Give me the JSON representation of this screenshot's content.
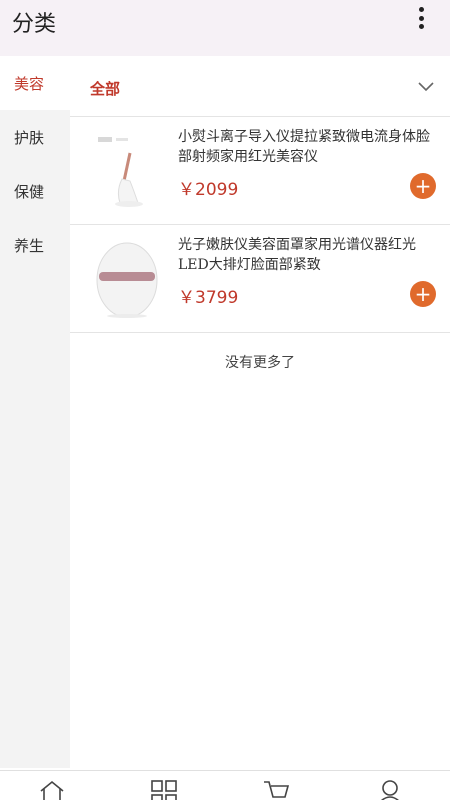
{
  "header": {
    "title": "分类",
    "menu_icon": "more-vertical-icon"
  },
  "sidebar": {
    "items": [
      {
        "label": "美容",
        "active": true
      },
      {
        "label": "护肤",
        "active": false
      },
      {
        "label": "保健",
        "active": false
      },
      {
        "label": "养生",
        "active": false
      }
    ]
  },
  "category": {
    "label": "全部",
    "expand_icon": "chevron-down-icon"
  },
  "products": [
    {
      "name": "小熨斗离子导入仪提拉紧致微电流身体脸部射频家用红光美容仪",
      "price": "￥2099",
      "add_icon": "plus-icon"
    },
    {
      "name": "光子嫩肤仪美容面罩家用光谱仪器红光LED大排灯脸面部紧致",
      "price": "￥3799",
      "add_icon": "plus-icon"
    }
  ],
  "list_footer": "没有更多了",
  "bottom_nav": {
    "items": [
      {
        "icon": "home-icon"
      },
      {
        "icon": "category-grid-icon"
      },
      {
        "icon": "cart-icon"
      },
      {
        "icon": "user-icon"
      }
    ]
  },
  "colors": {
    "accent": "#c0392b",
    "add_button": "#e06a2c",
    "header_bg": "#f6f1f6",
    "sidebar_bg": "#f3f3f3"
  }
}
